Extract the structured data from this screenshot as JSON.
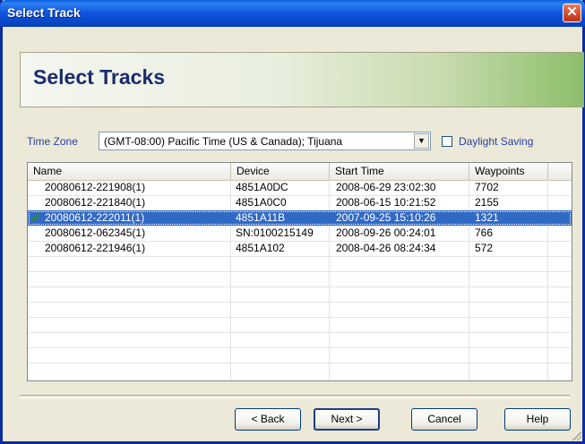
{
  "window": {
    "title": "Select Track",
    "close_glyph": "✕"
  },
  "banner": {
    "title": "Select Tracks"
  },
  "timezone": {
    "label": "Time Zone",
    "selected": "(GMT-08:00) Pacific Time (US & Canada); Tijuana",
    "arrow_glyph": "▼"
  },
  "daylight": {
    "label": "Daylight Saving",
    "checked": false
  },
  "table": {
    "columns": [
      "Name",
      "Device",
      "Start Time",
      "Waypoints"
    ],
    "rows": [
      {
        "name": "20080612-221908(1)",
        "device": "4851A0DC",
        "start": "2008-06-29 23:02:30",
        "waypoints": "7702",
        "checked": false,
        "selected": false
      },
      {
        "name": "20080612-221840(1)",
        "device": "4851A0C0",
        "start": "2008-06-15 10:21:52",
        "waypoints": "2155",
        "checked": false,
        "selected": false
      },
      {
        "name": "20080612-222011(1)",
        "device": "4851A11B",
        "start": "2007-09-25 15:10:26",
        "waypoints": "1321",
        "checked": true,
        "selected": true
      },
      {
        "name": "20080612-062345(1)",
        "device": "SN:0100215149",
        "start": "2008-09-26 00:24:01",
        "waypoints": "766",
        "checked": false,
        "selected": false
      },
      {
        "name": "20080612-221946(1)",
        "device": "4851A102",
        "start": "2008-04-26 08:24:34",
        "waypoints": "572",
        "checked": false,
        "selected": false
      }
    ],
    "check_glyph": "✔"
  },
  "buttons": {
    "back": "< Back",
    "next": "Next >",
    "cancel": "Cancel",
    "help": "Help"
  },
  "colors": {
    "selection": "#316AC5",
    "titlebar": "#0A4BD0",
    "check": "#2A8A3A"
  }
}
